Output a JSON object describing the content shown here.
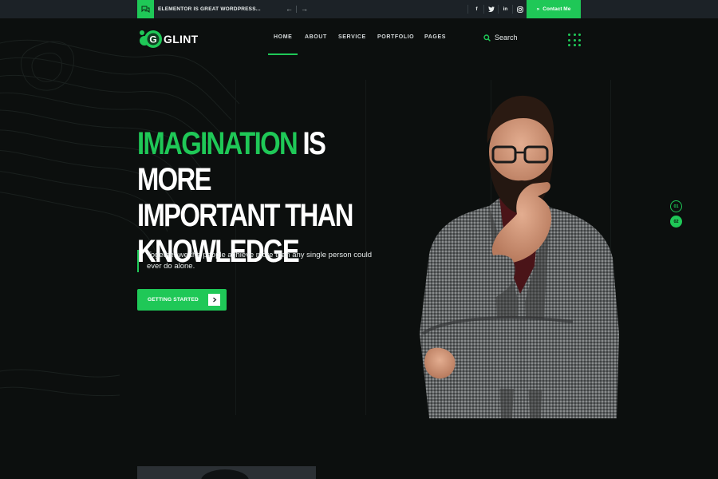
{
  "topbar": {
    "ticker_text": "ELEMENTOR IS GREAT WORDPRESS...",
    "prev_arrow": "←",
    "next_arrow": "→",
    "socials": [
      {
        "name": "facebook",
        "glyph": "f"
      },
      {
        "name": "twitter",
        "glyph": "t"
      },
      {
        "name": "linkedin",
        "glyph": "in"
      },
      {
        "name": "instagram",
        "glyph": "◎"
      }
    ],
    "contact_label": "Contact Me",
    "contact_arrow": "»"
  },
  "header": {
    "logo_text": "GLINT",
    "logo_letter": "G",
    "nav": [
      "HOME",
      "ABOUT",
      "SERVICE",
      "PORTFOLIO",
      "PAGES"
    ],
    "active_nav": "HOME",
    "search_label": "Search"
  },
  "hero": {
    "headline_green": "IMAGINATION",
    "headline_line1_rest": " IS MORE",
    "headline_line2": "IMPORTANT THAN",
    "headline_line3": "KNOWLEDGE",
    "subtitle": "Together we the people achieve more than any single person could ever do alone.",
    "cta_label": "GETTING STARTED",
    "cta_arrow": "›"
  },
  "slider": {
    "dots": [
      "01",
      "02"
    ],
    "active": "02"
  },
  "colors": {
    "accent": "#1fc857",
    "background": "#0c0f0e",
    "topbar": "#1c2227"
  }
}
